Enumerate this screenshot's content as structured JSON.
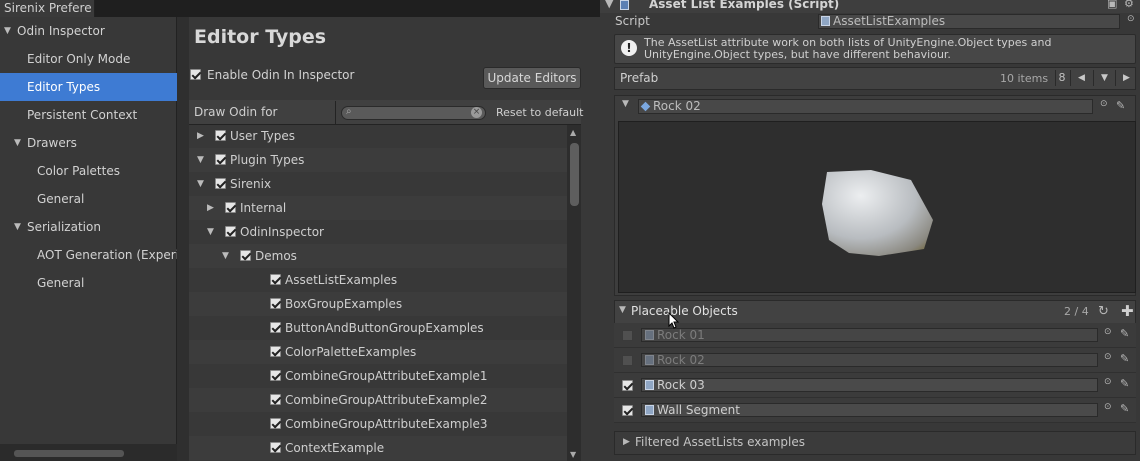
{
  "left_window": {
    "tab_title": "Sirenix Prefere",
    "tree": [
      {
        "label": "Odin Inspector",
        "expanded": true,
        "level": 0
      },
      {
        "label": "Editor Only Mode",
        "level": 1
      },
      {
        "label": "Editor Types",
        "level": 1,
        "selected": true
      },
      {
        "label": "Persistent Context",
        "level": 1
      },
      {
        "label": "Drawers",
        "expanded": true,
        "level": 1
      },
      {
        "label": "Color Palettes",
        "level": 2
      },
      {
        "label": "General",
        "level": 2
      },
      {
        "label": "Serialization",
        "expanded": true,
        "level": 1
      },
      {
        "label": "AOT Generation (Experin",
        "level": 2
      },
      {
        "label": "General",
        "level": 2
      }
    ],
    "page_title": "Editor Types",
    "enable_label": "Enable Odin In Inspector",
    "update_button": "Update Editors",
    "draw_for_label": "Draw Odin for",
    "search_placeholder": "",
    "reset_button": "Reset to default",
    "type_list": [
      {
        "label": "User Types",
        "level": 0,
        "arrow": "right",
        "checked": true
      },
      {
        "label": "Plugin Types",
        "level": 0,
        "arrow": "down",
        "checked": true
      },
      {
        "label": "Sirenix",
        "level": 1,
        "arrow": "down",
        "checked": true
      },
      {
        "label": "Internal",
        "level": 2,
        "arrow": "right",
        "checked": true
      },
      {
        "label": "OdinInspector",
        "level": 2,
        "arrow": "down",
        "checked": true
      },
      {
        "label": "Demos",
        "level": 3,
        "arrow": "down",
        "checked": true
      },
      {
        "label": "AssetListExamples",
        "level": 4,
        "checked": true
      },
      {
        "label": "BoxGroupExamples",
        "level": 4,
        "checked": true
      },
      {
        "label": "ButtonAndButtonGroupExamples",
        "level": 4,
        "checked": true
      },
      {
        "label": "ColorPaletteExamples",
        "level": 4,
        "checked": true
      },
      {
        "label": "CombineGroupAttributeExample1",
        "level": 4,
        "checked": true
      },
      {
        "label": "CombineGroupAttributeExample2",
        "level": 4,
        "checked": true
      },
      {
        "label": "CombineGroupAttributeExample3",
        "level": 4,
        "checked": true
      },
      {
        "label": "ContextExample",
        "level": 4,
        "checked": true
      }
    ]
  },
  "inspector": {
    "component_title": "Asset List Examples (Script)",
    "script_label": "Script",
    "script_value": "AssetListExamples",
    "help_text": "The AssetList attribute work on both lists of UnityEngine.Object types and UnityEngine.Object types, but have different behaviour.",
    "prefab_label": "Prefab",
    "items_count": "10 items",
    "page_number": "8",
    "rock_field": "Rock 02",
    "placeable_title": "Placeable Objects",
    "placeable_ratio": "2 / 4",
    "placeable_items": [
      {
        "label": "Rock 01",
        "checked": false
      },
      {
        "label": "Rock 02",
        "checked": false
      },
      {
        "label": "Rock 03",
        "checked": true
      },
      {
        "label": "Wall Segment",
        "checked": true
      }
    ],
    "filtered_title": "Filtered AssetLists examples"
  },
  "colors": {
    "selection": "#3e7bd3",
    "panel": "#383838",
    "background": "#1e1e1e"
  }
}
